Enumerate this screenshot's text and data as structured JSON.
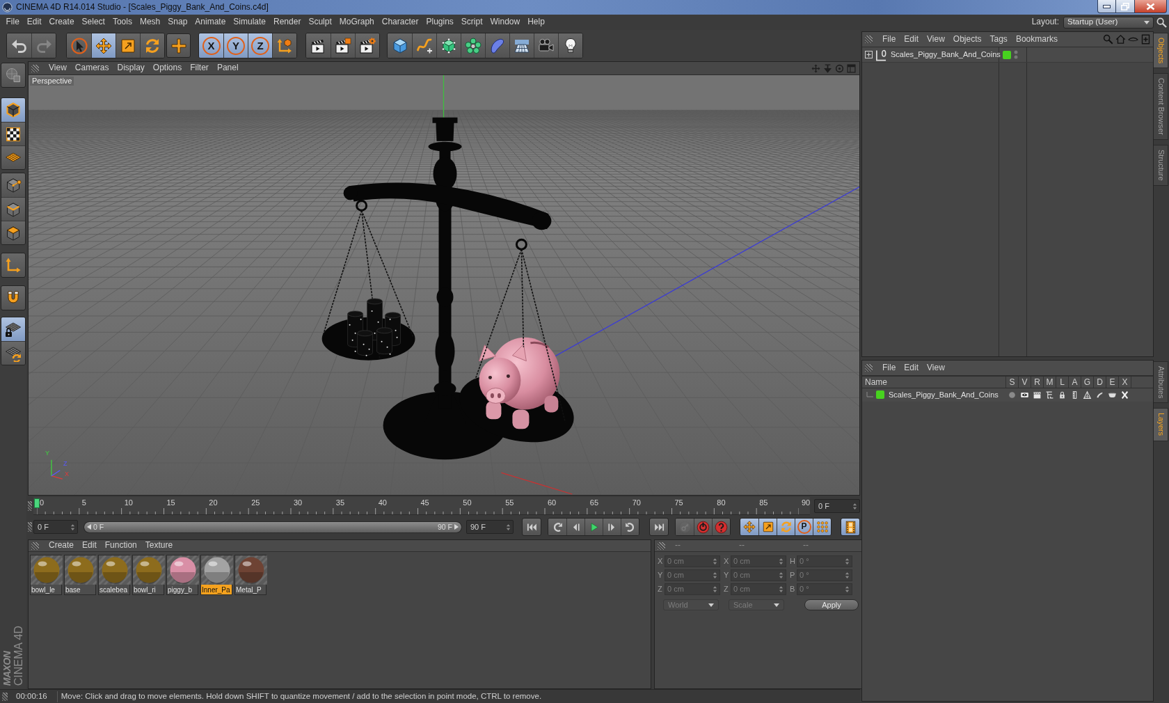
{
  "window": {
    "title": "CINEMA 4D R14.014 Studio - [Scales_Piggy_Bank_And_Coins.c4d]"
  },
  "menu_bar": {
    "items": [
      "File",
      "Edit",
      "Create",
      "Select",
      "Tools",
      "Mesh",
      "Snap",
      "Animate",
      "Simulate",
      "Render",
      "Sculpt",
      "MoGraph",
      "Character",
      "Plugins",
      "Script",
      "Window",
      "Help"
    ],
    "layout_label": "Layout:",
    "layout_value": "Startup (User)"
  },
  "toolbar": {
    "history": [
      {
        "disabled": false
      },
      {
        "disabled": true
      }
    ],
    "tools": [
      {
        "selected": false
      },
      {
        "selected": true
      },
      {
        "selected": false
      },
      {
        "selected": false
      }
    ],
    "axis_locks": [
      {
        "label": "X",
        "on": true
      },
      {
        "label": "Y",
        "on": true
      },
      {
        "label": "Z",
        "on": true
      }
    ]
  },
  "mode_palette": {
    "modes": [
      {
        "selected": true
      },
      {
        "selected": false
      },
      {
        "selected": false
      },
      {
        "selected": false
      },
      {
        "selected": false
      },
      {
        "selected": false
      }
    ],
    "toggles": [
      {
        "on": false
      },
      {
        "on": false
      },
      {
        "on": true
      },
      {
        "on": false
      }
    ]
  },
  "brand": {
    "maker": "MAXON",
    "product": "CINEMA 4D"
  },
  "viewport": {
    "menu": [
      "View",
      "Cameras",
      "Display",
      "Options",
      "Filter",
      "Panel"
    ],
    "camera": "Perspective",
    "axis_labels": [
      "Y",
      "Z",
      "X"
    ]
  },
  "timeline": {
    "tick_labels": [
      "0",
      "5",
      "10",
      "15",
      "20",
      "25",
      "30",
      "35",
      "40",
      "45",
      "50",
      "55",
      "60",
      "65",
      "70",
      "75",
      "80",
      "85",
      "90"
    ],
    "playhead": {
      "level": 0
    },
    "frame_field": "0 F"
  },
  "transport": {
    "start_field": "0 F",
    "range": {
      "start": "0 F",
      "end": "90 F",
      "level": 1
    },
    "end_field": "90 F",
    "record": [
      {
        "disabled": true
      },
      {
        "disabled": false
      },
      {
        "disabled": false
      }
    ],
    "key_filters": [
      {
        "on": true
      },
      {
        "on": true
      },
      {
        "on": true
      },
      {
        "label": "P",
        "on": true
      },
      {
        "on": true
      }
    ],
    "timeline_toggle": {
      "on": true
    }
  },
  "materials": {
    "menu": [
      "Create",
      "Edit",
      "Function",
      "Texture"
    ],
    "items": [
      {
        "name": "bowl_le",
        "color": "#8d6c1d",
        "selected": false
      },
      {
        "name": "base",
        "color": "#8d6c1d",
        "selected": false
      },
      {
        "name": "scalebea",
        "color": "#8d6c1d",
        "selected": false
      },
      {
        "name": "bowl_ri",
        "color": "#8d6c1d",
        "selected": false
      },
      {
        "name": "piggy_b",
        "color": "#d98fa6",
        "selected": false
      },
      {
        "name": "Inner_Pa",
        "color": "#a3a3a3",
        "selected": true
      },
      {
        "name": "Metal_P",
        "color": "#6e4334",
        "selected": false
      }
    ]
  },
  "coordinates": {
    "headers": [
      "--",
      "--",
      "--"
    ],
    "rows": [
      {
        "pos_axis": "X",
        "position": "0 cm",
        "size_axis": "X",
        "size": "0 cm",
        "rot_axis": "H",
        "rotation": "0 °"
      },
      {
        "pos_axis": "Y",
        "position": "0 cm",
        "size_axis": "Y",
        "size": "0 cm",
        "rot_axis": "P",
        "rotation": "0 °"
      },
      {
        "pos_axis": "Z",
        "position": "0 cm",
        "size_axis": "Z",
        "size": "0 cm",
        "rot_axis": "B",
        "rotation": "0 °"
      }
    ],
    "system": {
      "value": "World",
      "disabled": true
    },
    "mode": {
      "value": "Scale",
      "disabled": true
    },
    "apply": "Apply"
  },
  "status_bar": {
    "time": "00:00:16",
    "message": "Move: Click and drag to move elements. Hold down SHIFT to quantize movement / add to the selection in point mode, CTRL to remove."
  },
  "object_manager": {
    "menu": [
      "File",
      "Edit",
      "View",
      "Objects",
      "Tags",
      "Bookmarks"
    ],
    "objects": [
      {
        "name": "Scales_Piggy_Bank_And_Coins",
        "expanded": false,
        "color": "#47d21f"
      }
    ]
  },
  "layer_manager": {
    "menu": [
      "File",
      "Edit",
      "View"
    ],
    "columns": [
      "Name",
      "S",
      "V",
      "R",
      "M",
      "L",
      "A",
      "G",
      "D",
      "E",
      "X"
    ],
    "layers": [
      {
        "name": "Scales_Piggy_Bank_And_Coins",
        "color": "#47d21f"
      }
    ]
  },
  "side_tabs": {
    "upper": [
      {
        "label": "Objects",
        "selected": true
      },
      {
        "label": "Content Browser",
        "selected": false
      },
      {
        "label": "Structure",
        "selected": false
      }
    ],
    "lower": [
      {
        "label": "Attributes",
        "selected": false
      },
      {
        "label": "Layers",
        "selected": true
      }
    ]
  }
}
